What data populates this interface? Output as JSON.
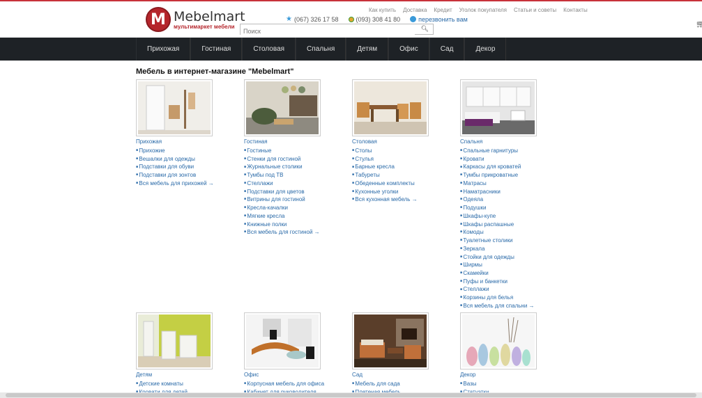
{
  "header": {
    "logo_letter": "M",
    "logo_name": "Mebelmart",
    "logo_sub": "мультимаркет мебели",
    "top_menu": [
      "Как купить",
      "Доставка",
      "Кредит",
      "Уголок покупателя",
      "Статьи и советы",
      "Контакты"
    ],
    "phone1": "(067) 326 17 58",
    "phone2": "(093) 308 41 80",
    "callback": "перезвонить вам",
    "search_placeholder": "Поиск"
  },
  "nav": [
    "Прихожая",
    "Гостиная",
    "Столовая",
    "Спальня",
    "Детям",
    "Офис",
    "Сад",
    "Декор"
  ],
  "page_title": "Мебель в интернет-магазине \"Mebelmart\"",
  "categories": [
    {
      "title": "Прихожая",
      "items": [
        "Прихожие",
        "Вешалки для одежды",
        "Подставки для обуви",
        "Подставки для зонтов",
        "Вся мебель для прихожей →"
      ]
    },
    {
      "title": "Гостиная",
      "items": [
        "Гостиные",
        "Стенки для гостиной",
        "Журнальные столики",
        "Тумбы под ТВ",
        "Стеллажи",
        "Подставки для цветов",
        "Витрины для гостиной",
        "Кресла-качалки",
        "Мягкие кресла",
        "Книжные полки",
        "Вся мебель для гостиной →"
      ]
    },
    {
      "title": "Столовая",
      "items": [
        "Столы",
        "Стулья",
        "Барные кресла",
        "Табуреты",
        "Обеденные комплекты",
        "Кухонные уголки",
        "Вся кухонная мебель →"
      ]
    },
    {
      "title": "Спальня",
      "items": [
        "Спальные гарнитуры",
        "Кровати",
        "Каркасы для кроватей",
        "Тумбы прикроватные",
        "Матрасы",
        "Наматрасники",
        "Одеяла",
        "Подушки",
        "Шкафы-купе",
        "Шкафы распашные",
        "Комоды",
        "Туалетные столики",
        "Зеркала",
        "Стойки для одежды",
        "Ширмы",
        "Скамейки",
        "Пуфы и банкетки",
        "Стеллажи",
        "Корзины для белья",
        "Вся мебель для спальни →"
      ]
    },
    {
      "title": "Детям",
      "items": [
        "Детские комнаты",
        "Кровати для детей"
      ]
    },
    {
      "title": "Офис",
      "items": [
        "Корпусная мебель для офиса",
        "Кабинет для руководителя"
      ]
    },
    {
      "title": "Сад",
      "items": [
        "Мебель для сада",
        "Плетеная мебель"
      ]
    },
    {
      "title": "Декор",
      "items": [
        "Вазы",
        "Статуэтки"
      ]
    }
  ],
  "colors": {
    "accent": "#c8323a",
    "nav_bg": "#1e2226",
    "link": "#2a6aa8"
  }
}
